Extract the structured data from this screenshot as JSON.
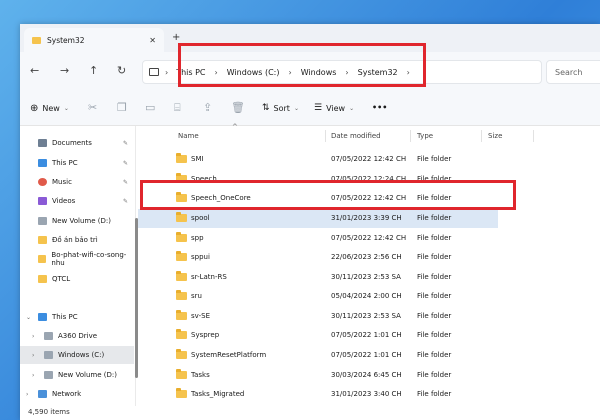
{
  "window": {
    "tab_title": "System32"
  },
  "toolbar": {
    "back": "←",
    "forward": "→",
    "up": "↑",
    "refresh": "↻",
    "new_label": "New",
    "sort_label": "Sort",
    "view_label": "View",
    "more_label": "•••"
  },
  "breadcrumb": [
    "This PC",
    "Windows (C:)",
    "Windows",
    "System32"
  ],
  "search": {
    "placeholder": "Search"
  },
  "sidebar": {
    "items": [
      {
        "label": "Documents",
        "icon": "document-icon",
        "pinned": true
      },
      {
        "label": "This PC",
        "icon": "computer-icon",
        "pinned": true
      },
      {
        "label": "Music",
        "icon": "music-icon",
        "pinned": true
      },
      {
        "label": "Videos",
        "icon": "video-icon",
        "pinned": true
      },
      {
        "label": "New Volume (D:)",
        "icon": "drive-icon",
        "pinned": false
      },
      {
        "label": "Đồ án bảo trì",
        "icon": "folder-icon",
        "pinned": false
      },
      {
        "label": "Bo-phat-wifi-co-song-nhu",
        "icon": "folder-icon",
        "pinned": false
      },
      {
        "label": "QTCL",
        "icon": "folder-icon",
        "pinned": false
      },
      {
        "label": "This PC",
        "icon": "computer-icon",
        "pinned": false
      },
      {
        "label": "A360 Drive",
        "icon": "drive-icon",
        "pinned": false
      },
      {
        "label": "Windows (C:)",
        "icon": "drive-icon",
        "pinned": false
      },
      {
        "label": "New Volume (D:)",
        "icon": "drive-icon",
        "pinned": false
      },
      {
        "label": "Network",
        "icon": "network-icon",
        "pinned": false
      }
    ]
  },
  "columns": {
    "name": "Name",
    "date": "Date modified",
    "type": "Type",
    "size": "Size"
  },
  "files": [
    {
      "name": "SMI",
      "date": "07/05/2022 12:42 CH",
      "type": "File folder"
    },
    {
      "name": "Speech",
      "date": "07/05/2022 12:24 CH",
      "type": "File folder"
    },
    {
      "name": "Speech_OneCore",
      "date": "07/05/2022 12:42 CH",
      "type": "File folder"
    },
    {
      "name": "spool",
      "date": "31/01/2023 3:39 CH",
      "type": "File folder"
    },
    {
      "name": "spp",
      "date": "07/05/2022 12:42 CH",
      "type": "File folder"
    },
    {
      "name": "sppui",
      "date": "22/06/2023 2:56 CH",
      "type": "File folder"
    },
    {
      "name": "sr-Latn-RS",
      "date": "30/11/2023 2:53 SA",
      "type": "File folder"
    },
    {
      "name": "sru",
      "date": "05/04/2024 2:00 CH",
      "type": "File folder"
    },
    {
      "name": "sv-SE",
      "date": "30/11/2023 2:53 SA",
      "type": "File folder"
    },
    {
      "name": "Sysprep",
      "date": "07/05/2022 1:01 CH",
      "type": "File folder"
    },
    {
      "name": "SystemResetPlatform",
      "date": "07/05/2022 1:01 CH",
      "type": "File folder"
    },
    {
      "name": "Tasks",
      "date": "30/03/2024 6:45 CH",
      "type": "File folder"
    },
    {
      "name": "Tasks_Migrated",
      "date": "31/01/2023 3:40 CH",
      "type": "File folder"
    }
  ],
  "status": {
    "item_count": "4,590 items"
  },
  "colors": {
    "highlight": "#e0262d",
    "folder": "#f5c34d",
    "selected_row": "#dbe7f5"
  }
}
